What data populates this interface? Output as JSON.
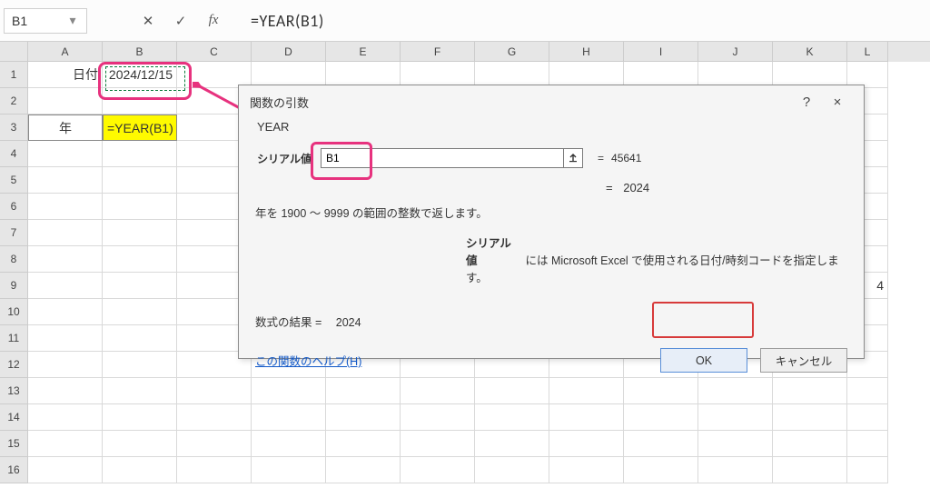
{
  "formula_bar": {
    "name_box": "B1",
    "formula": "=YEAR(B1)"
  },
  "columns": [
    "A",
    "B",
    "C",
    "D",
    "E",
    "F",
    "G",
    "H",
    "I",
    "J",
    "K",
    "L"
  ],
  "rows": [
    "1",
    "2",
    "3",
    "4",
    "5",
    "6",
    "7",
    "8",
    "9",
    "10",
    "11",
    "12",
    "13",
    "14",
    "15",
    "16"
  ],
  "cells": {
    "a1": "日付",
    "b1": "2024/12/15",
    "a3": "年",
    "b3": "=YEAR(B1)",
    "l9": "4"
  },
  "dialog": {
    "title": "関数の引数",
    "help_label": "?",
    "close_label": "×",
    "function_name": "YEAR",
    "arg_label": "シリアル値",
    "arg_value": "B1",
    "arg_eval_eq": "=",
    "arg_evaluated": "45641",
    "result_eq": "=",
    "result": "2024",
    "description": "年を 1900 ～ 9999 の範囲の整数で返します。",
    "arg_desc_label": "シリアル値",
    "arg_desc": "には Microsoft Excel で使用される日付/時刻コードを指定します。",
    "formula_result_label": "数式の結果 =",
    "formula_result": "2024",
    "help_link": "この関数のヘルプ(H)",
    "ok": "OK",
    "cancel": "キャンセル"
  }
}
